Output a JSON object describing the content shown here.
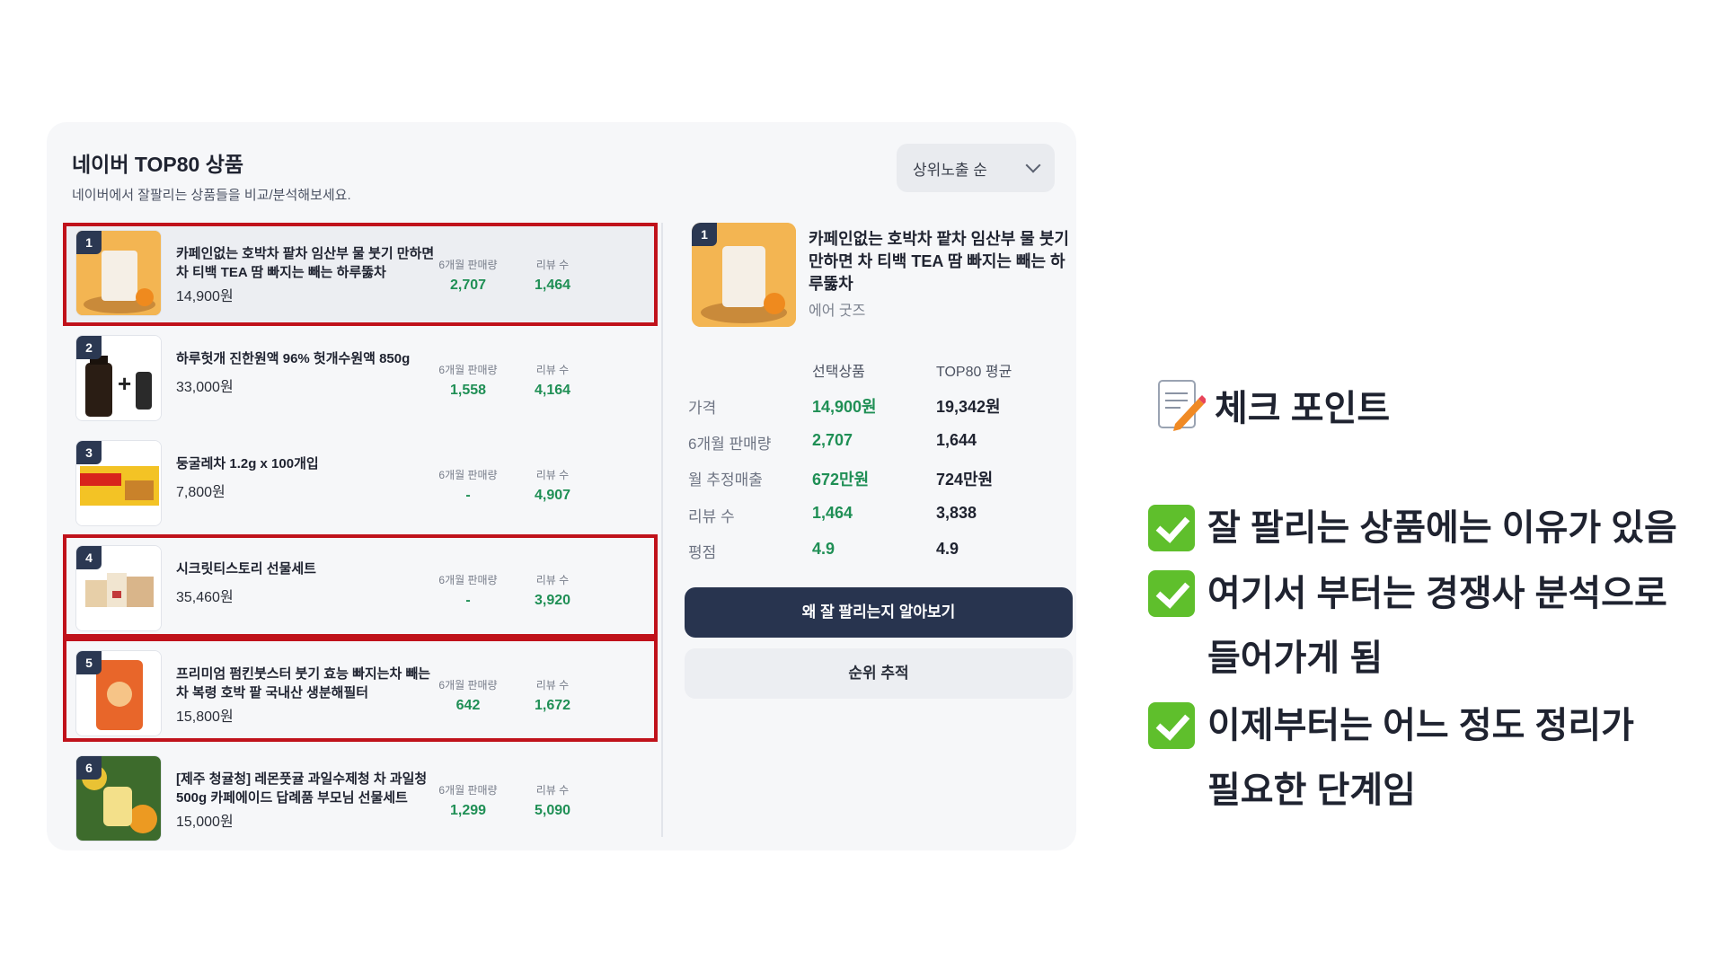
{
  "card": {
    "title": "네이버 TOP80 상품",
    "subtitle": "네이버에서 잘팔리는 상품들을 비교/분석해보세요.",
    "sort_label": "상위노출 순"
  },
  "stat_labels": {
    "sales": "6개월 판매량",
    "reviews": "리뷰 수"
  },
  "products": [
    {
      "rank": "1",
      "name": "카페인없는 호박차 팥차 임산부 물 붓기 만하면 차 티백 TEA 땀 빠지는 빼는 하루뚫차",
      "price": "14,900원",
      "sales": "2,707",
      "reviews": "1,464"
    },
    {
      "rank": "2",
      "name": "하루헛개 진한원액 96% 헛개수원액 850g",
      "price": "33,000원",
      "sales": "1,558",
      "reviews": "4,164"
    },
    {
      "rank": "3",
      "name": "둥굴레차 1.2g x 100개입",
      "price": "7,800원",
      "sales": "-",
      "reviews": "4,907"
    },
    {
      "rank": "4",
      "name": "시크릿티스토리 선물세트",
      "price": "35,460원",
      "sales": "-",
      "reviews": "3,920"
    },
    {
      "rank": "5",
      "name": "프리미엄 펌킨붓스터 붓기 효능 빠지는차 빼는차 복령 호박 팥 국내산 생분해필터",
      "price": "15,800원",
      "sales": "642",
      "reviews": "1,672"
    },
    {
      "rank": "6",
      "name": "[제주 청귤청] 레몬풋귤 과일수제청 차 과일청 500g 카페에이드 답례품 부모님 선물세트",
      "price": "15,000원",
      "sales": "1,299",
      "reviews": "5,090"
    }
  ],
  "detail": {
    "rank": "1",
    "name": "카페인없는 호박차 팥차 임산부 물 붓기 만하면 차 티백 TEA 땀 빠지는 빼는 하루뚫차",
    "seller": "에어 굿즈",
    "col_selected": "선택상품",
    "col_avg": "TOP80 평균",
    "rows": [
      {
        "label": "가격",
        "selected": "14,900원",
        "avg": "19,342원"
      },
      {
        "label": "6개월 판매량",
        "selected": "2,707",
        "avg": "1,644"
      },
      {
        "label": "월 추정매출",
        "selected": "672만원",
        "avg": "724만원"
      },
      {
        "label": "리뷰 수",
        "selected": "1,464",
        "avg": "3,838"
      },
      {
        "label": "평점",
        "selected": "4.9",
        "avg": "4.9"
      }
    ],
    "primary_button": "왜 잘 팔리는지 알아보기",
    "secondary_button": "순위 추적"
  },
  "checkpoints": {
    "title": "체크 포인트",
    "items": [
      {
        "line1": "잘 팔리는 상품에는 이유가 있음",
        "line2": ""
      },
      {
        "line1": "여기서 부터는 경쟁사 분석으로",
        "line2": "들어가게 됨"
      },
      {
        "line1": "이제부터는 어느 정도 정리가",
        "line2": "필요한 단계임"
      }
    ]
  },
  "colors": {
    "accent_green": "#1f8f55",
    "navy": "#28344f",
    "highlight_red": "#c0121b",
    "check_green": "#5fbf2c"
  }
}
